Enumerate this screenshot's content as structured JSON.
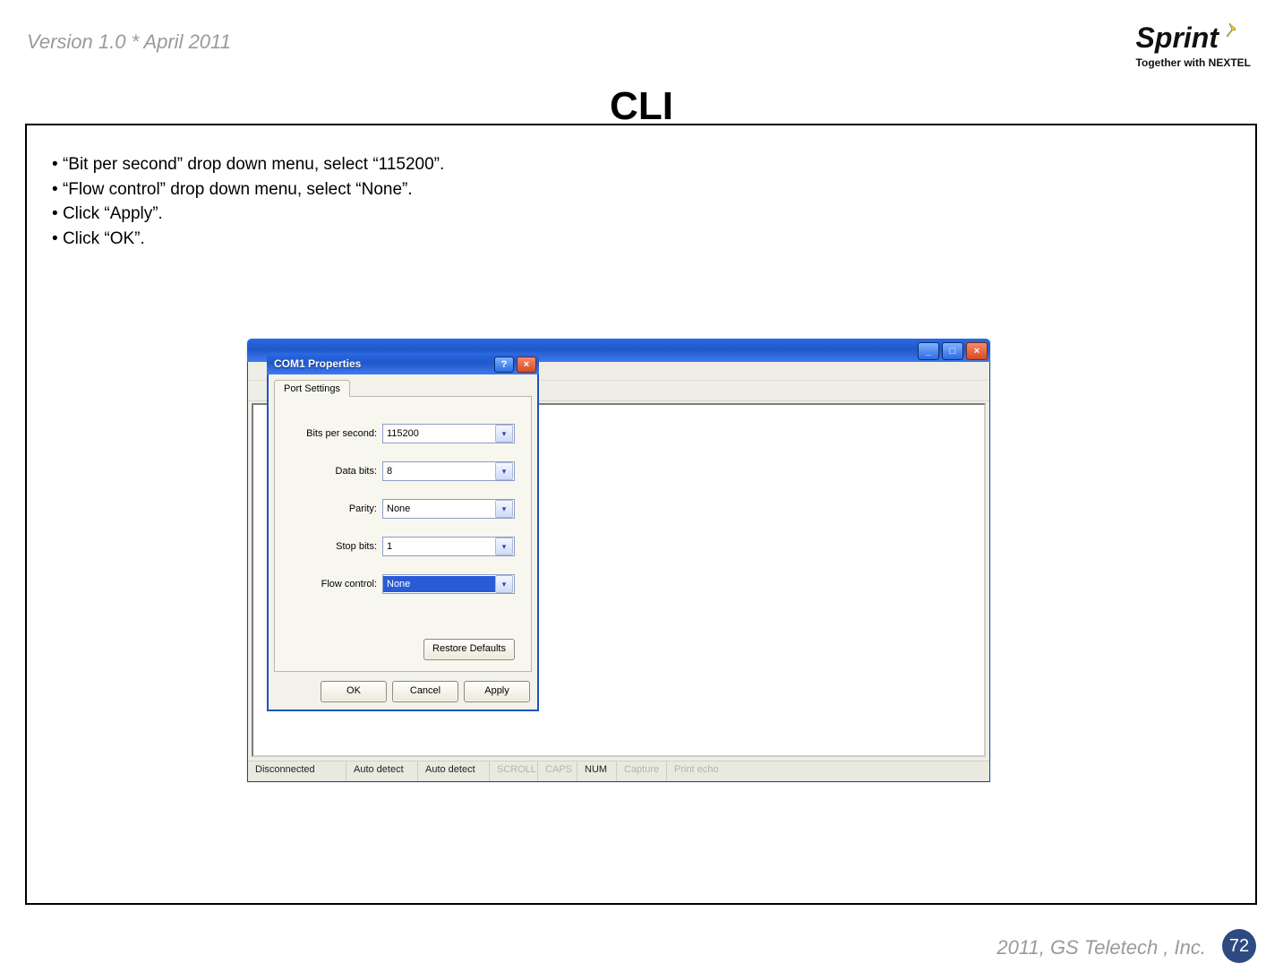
{
  "header": {
    "version_text": "Version 1.0 * April 2011",
    "logo_text": "Sprint",
    "logo_tagline": "Together with NEXTEL"
  },
  "title": "CLI",
  "bullets": [
    "“Bit per second” drop down menu, select “115200”.",
    "“Flow control” drop down menu, select “None”.",
    "Click “Apply”.",
    "Click “OK”."
  ],
  "hyperterminal": {
    "status": {
      "conn": "Disconnected",
      "emul1": "Auto detect",
      "emul2": "Auto detect",
      "scroll": "SCROLL",
      "caps": "CAPS",
      "num": "NUM",
      "capture": "Capture",
      "printecho": "Print echo"
    }
  },
  "dialog": {
    "title": "COM1 Properties",
    "tab_label": "Port Settings",
    "fields": {
      "bits_per_second": {
        "label": "Bits per second:",
        "value": "115200"
      },
      "data_bits": {
        "label": "Data bits:",
        "value": "8"
      },
      "parity": {
        "label": "Parity:",
        "value": "None"
      },
      "stop_bits": {
        "label": "Stop bits:",
        "value": "1"
      },
      "flow_control": {
        "label": "Flow control:",
        "value": "None"
      }
    },
    "restore_label": "Restore Defaults",
    "buttons": {
      "ok": "OK",
      "cancel": "Cancel",
      "apply": "Apply"
    }
  },
  "footer": {
    "copyright": "2011, GS Teletech , Inc.",
    "page_number": "72"
  }
}
